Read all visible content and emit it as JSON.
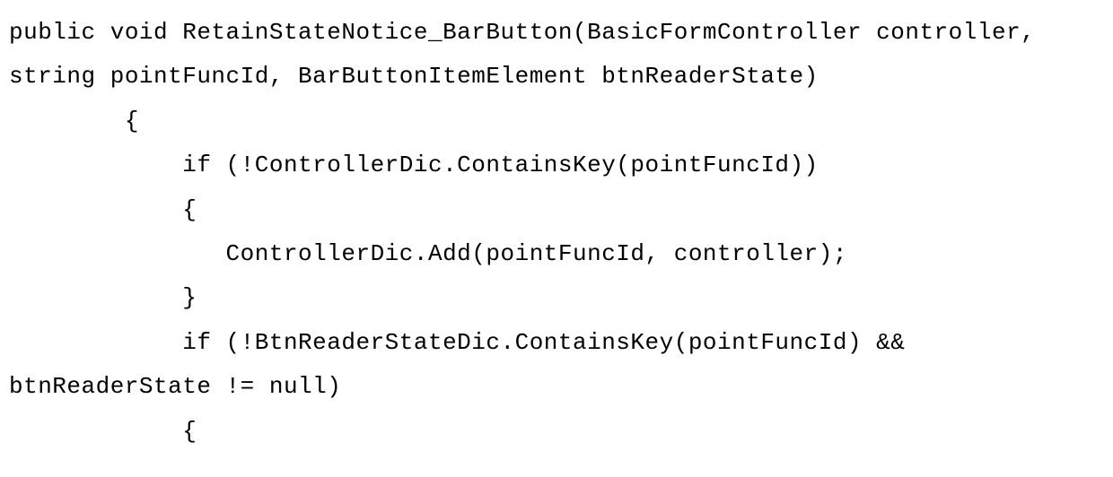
{
  "code": {
    "line1": "public void RetainStateNotice_BarButton(BasicFormController controller,",
    "line2": "string pointFuncId, BarButtonItemElement btnReaderState)",
    "line3": "        {",
    "line4": "            if (!ControllerDic.ContainsKey(pointFuncId))",
    "line5": "            {",
    "line6": "               ControllerDic.Add(pointFuncId, controller);",
    "line7": "            }",
    "line8": "            if (!BtnReaderStateDic.ContainsKey(pointFuncId) &&",
    "line9": "btnReaderState != null)",
    "line10": "            {"
  }
}
